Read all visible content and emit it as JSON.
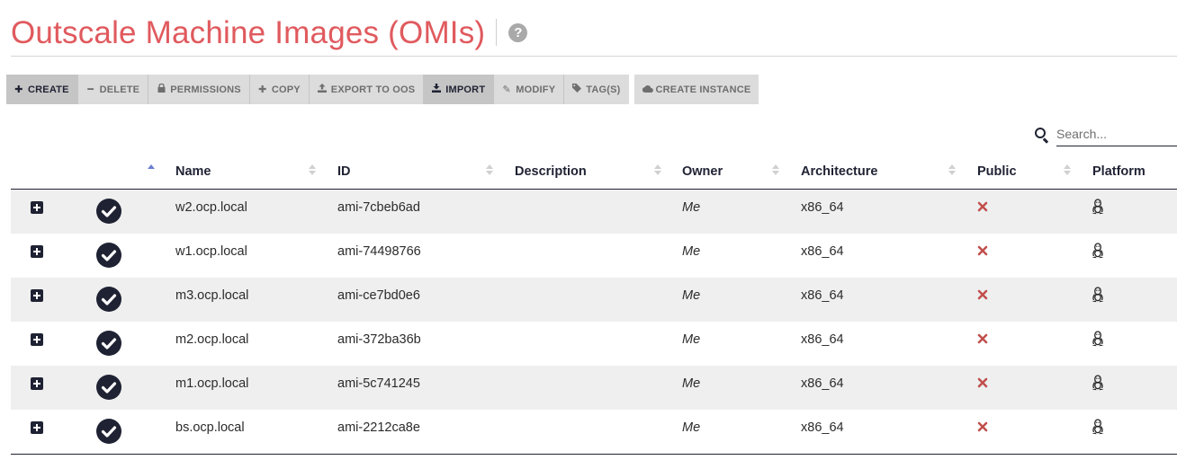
{
  "page": {
    "title": "Outscale Machine Images (OMIs)",
    "help_icon": "question-circle-icon"
  },
  "toolbar": {
    "buttons": [
      {
        "label": "CREATE",
        "icon": "plus-icon"
      },
      {
        "label": "DELETE",
        "icon": "minus-icon"
      },
      {
        "label": "PERMISSIONS",
        "icon": "lock-icon"
      },
      {
        "label": "COPY",
        "icon": "plus-icon"
      },
      {
        "label": "EXPORT TO OOS",
        "icon": "upload-icon"
      },
      {
        "label": "IMPORT",
        "icon": "download-icon"
      },
      {
        "label": "MODIFY",
        "icon": "pencil-icon"
      },
      {
        "label": "TAG(S)",
        "icon": "tag-icon"
      }
    ],
    "create_instance": {
      "label": "CREATE INSTANCE",
      "icon": "cloud-icon"
    }
  },
  "search": {
    "placeholder": "Search...",
    "value": ""
  },
  "table": {
    "columns": [
      "Name",
      "ID",
      "Description",
      "Owner",
      "Architecture",
      "Public",
      "Platform"
    ],
    "sorted_column": "Name",
    "rows": [
      {
        "name": "w2.ocp.local",
        "id": "ami-7cbeb6ad",
        "description": "",
        "owner": "Me",
        "architecture": "x86_64",
        "public": false,
        "platform": "linux"
      },
      {
        "name": "w1.ocp.local",
        "id": "ami-74498766",
        "description": "",
        "owner": "Me",
        "architecture": "x86_64",
        "public": false,
        "platform": "linux"
      },
      {
        "name": "m3.ocp.local",
        "id": "ami-ce7bd0e6",
        "description": "",
        "owner": "Me",
        "architecture": "x86_64",
        "public": false,
        "platform": "linux"
      },
      {
        "name": "m2.ocp.local",
        "id": "ami-372ba36b",
        "description": "",
        "owner": "Me",
        "architecture": "x86_64",
        "public": false,
        "platform": "linux"
      },
      {
        "name": "m1.ocp.local",
        "id": "ami-5c741245",
        "description": "",
        "owner": "Me",
        "architecture": "x86_64",
        "public": false,
        "platform": "linux"
      },
      {
        "name": "bs.ocp.local",
        "id": "ami-2212ca8e",
        "description": "",
        "owner": "Me",
        "architecture": "x86_64",
        "public": false,
        "platform": "linux"
      }
    ]
  },
  "colors": {
    "title": "#e05a5e",
    "dark": "#1f2233",
    "public_no": "#c0504d",
    "sort_active": "#6b7fd0"
  }
}
